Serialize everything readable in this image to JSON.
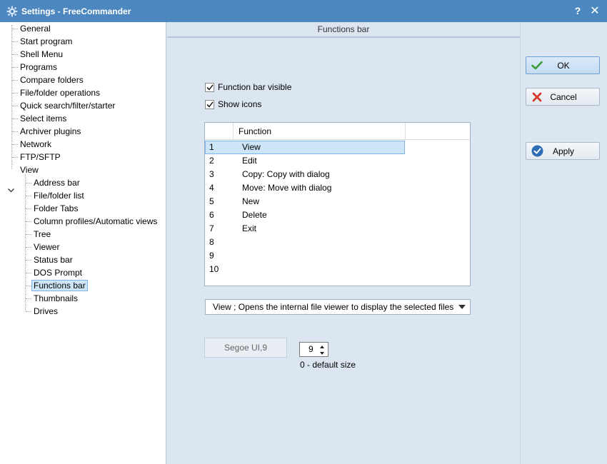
{
  "window": {
    "title": "Settings - FreeCommander",
    "help_label": "?",
    "close_label": "✕"
  },
  "tree": {
    "top_items": [
      "General",
      "Start program",
      "Shell Menu",
      "Programs",
      "Compare folders",
      "File/folder operations",
      "Quick search/filter/starter",
      "Select items",
      "Archiver plugins",
      "Network",
      "FTP/SFTP",
      "View"
    ],
    "view_children": [
      "Address bar",
      "File/folder list",
      "Folder Tabs",
      "Column profiles/Automatic views",
      "Tree",
      "Viewer",
      "Status bar",
      "DOS Prompt",
      "Functions bar",
      "Thumbnails",
      "Drives"
    ],
    "selected": "Functions bar"
  },
  "main": {
    "header": "Functions bar",
    "checkboxes": [
      {
        "label": "Function bar visible",
        "checked": true
      },
      {
        "label": "Show icons",
        "checked": true
      }
    ],
    "list": {
      "columns": [
        "",
        "Function",
        ""
      ],
      "rows": [
        {
          "num": "1",
          "fn": "View",
          "selected": true
        },
        {
          "num": "2",
          "fn": "Edit"
        },
        {
          "num": "3",
          "fn": "Copy: Copy with dialog"
        },
        {
          "num": "4",
          "fn": "Move: Move with dialog"
        },
        {
          "num": "5",
          "fn": "New"
        },
        {
          "num": "6",
          "fn": "Delete"
        },
        {
          "num": "7",
          "fn": "Exit"
        },
        {
          "num": "8",
          "fn": ""
        },
        {
          "num": "9",
          "fn": ""
        },
        {
          "num": "10",
          "fn": ""
        }
      ]
    },
    "dropdown_value": "View ; Opens the internal file viewer to display the selected files",
    "font_button": "Segoe UI,9",
    "font_size": "9",
    "font_size_hint": "0 - default size"
  },
  "buttons": {
    "ok": "OK",
    "cancel": "Cancel",
    "apply": "Apply"
  },
  "colors": {
    "titlebar": "#4d87bf",
    "selection": "#cde6f7",
    "ok_green": "#3a9a3a",
    "cancel_red": "#d23b2e",
    "apply_blue": "#2d6db5"
  }
}
